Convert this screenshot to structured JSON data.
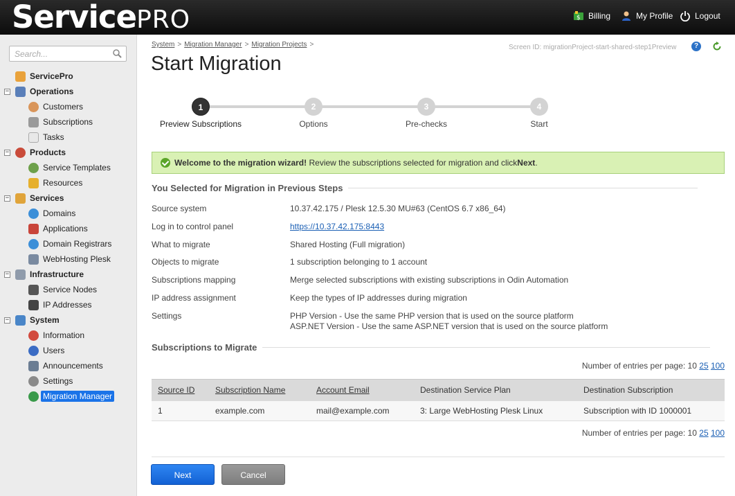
{
  "header": {
    "logo_bold": "Service",
    "logo_light": "PRO",
    "billing": "Billing",
    "my_profile": "My Profile",
    "logout": "Logout"
  },
  "sidebar": {
    "search_placeholder": "Search...",
    "root": "ServicePro",
    "groups": [
      {
        "label": "Operations",
        "items": [
          "Customers",
          "Subscriptions",
          "Tasks"
        ]
      },
      {
        "label": "Products",
        "items": [
          "Service Templates",
          "Resources"
        ]
      },
      {
        "label": "Services",
        "items": [
          "Domains",
          "Applications",
          "Domain Registrars",
          "WebHosting Plesk"
        ]
      },
      {
        "label": "Infrastructure",
        "items": [
          "Service Nodes",
          "IP Addresses"
        ]
      },
      {
        "label": "System",
        "items": [
          "Information",
          "Users",
          "Announcements",
          "Settings",
          "Migration Manager"
        ]
      }
    ],
    "toggle_symbol": "−"
  },
  "breadcrumb": {
    "items": [
      "System",
      "Migration Manager",
      "Migration Projects"
    ],
    "separator": ">"
  },
  "screen_id": "Screen ID:  migrationProject-start-shared-step1Preview",
  "page_title": "Start Migration",
  "steps": [
    {
      "num": "1",
      "label": "Preview Subscriptions",
      "active": true
    },
    {
      "num": "2",
      "label": "Options",
      "active": false
    },
    {
      "num": "3",
      "label": "Pre-checks",
      "active": false
    },
    {
      "num": "4",
      "label": "Start",
      "active": false
    }
  ],
  "message": {
    "bold": "Welcome to the migration wizard!",
    "text": " Review the subscriptions selected for migration and click ",
    "bold2": "Next",
    "end": "."
  },
  "summary": {
    "heading": "You Selected for Migration in Previous Steps",
    "rows": [
      {
        "key": "Source system",
        "value": "10.37.42.175 / Plesk 12.5.30 MU#63 (CentOS 6.7 x86_64)"
      },
      {
        "key": "Log in to control panel",
        "value": "https://10.37.42.175:8443"
      },
      {
        "key": "What to migrate",
        "value": "Shared Hosting (Full migration)"
      },
      {
        "key": "Objects to migrate",
        "value": "1 subscription belonging to 1 account"
      },
      {
        "key": "Subscriptions mapping",
        "value": "Merge selected subscriptions with existing subscriptions in Odin Automation"
      },
      {
        "key": "IP address assignment",
        "value": "Keep the types of IP addresses during migration"
      },
      {
        "key": "Settings",
        "value": "PHP Version - Use the same PHP version that is used on the source platform",
        "value2": "ASP.NET Version - Use the same ASP.NET version that is used on the source platform"
      }
    ]
  },
  "subscriptions": {
    "heading": "Subscriptions to Migrate",
    "per_page_label": "Number of entries per page: 10",
    "per_page_25": "25",
    "per_page_100": "100",
    "columns": [
      "Source ID",
      "Subscription Name",
      "Account Email",
      "Destination Service Plan",
      "Destination Subscription"
    ],
    "rows": [
      [
        "1",
        "example.com",
        "mail@example.com",
        "3: Large WebHosting Plesk Linux",
        "Subscription with ID 1000001"
      ]
    ]
  },
  "buttons": {
    "next": "Next",
    "cancel": "Cancel"
  }
}
